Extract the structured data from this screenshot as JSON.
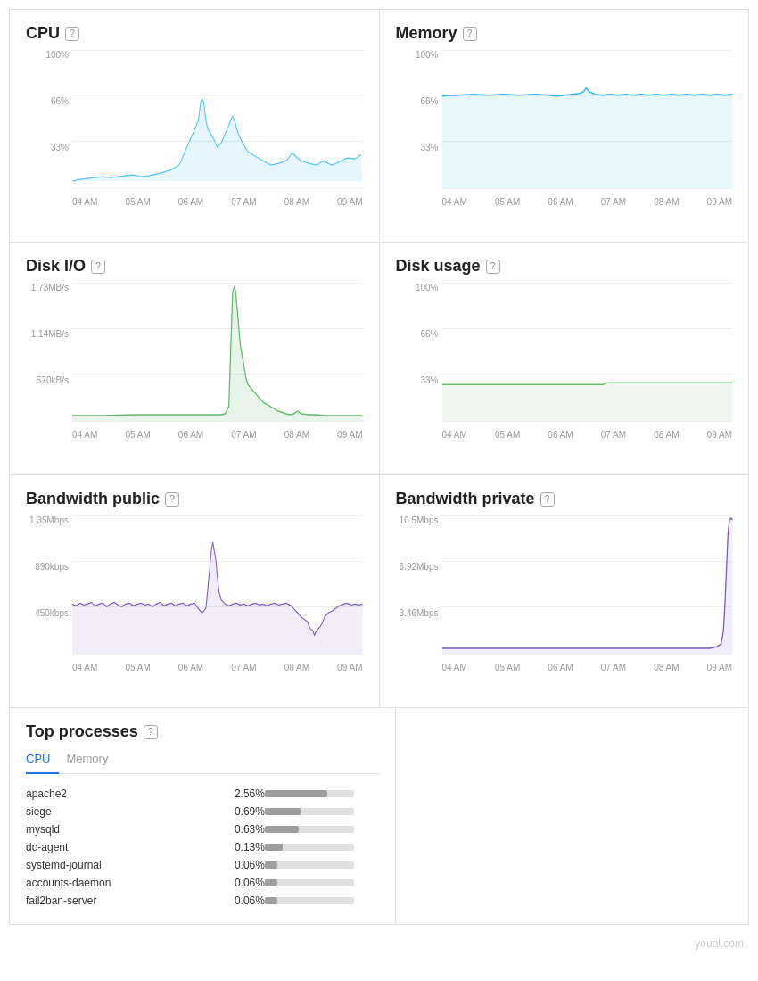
{
  "panels": {
    "cpu": {
      "title": "CPU",
      "y_labels": [
        "100%",
        "66%",
        "33%",
        ""
      ],
      "x_labels": [
        "04 AM",
        "05 AM",
        "06 AM",
        "07 AM",
        "08 AM",
        "09 AM"
      ],
      "color": "#4fc3f7"
    },
    "memory": {
      "title": "Memory",
      "y_labels": [
        "100%",
        "66%",
        "33%",
        ""
      ],
      "x_labels": [
        "04 AM",
        "05 AM",
        "06 AM",
        "07 AM",
        "08 AM",
        "09 AM"
      ],
      "color": "#29b6f6"
    },
    "disk_io": {
      "title": "Disk I/O",
      "y_labels": [
        "1.73MB/s",
        "1.14MB/s",
        "570kB/s",
        ""
      ],
      "x_labels": [
        "04 AM",
        "05 AM",
        "06 AM",
        "07 AM",
        "08 AM",
        "09 AM"
      ],
      "color": "#66bb6a"
    },
    "disk_usage": {
      "title": "Disk usage",
      "y_labels": [
        "100%",
        "66%",
        "33%",
        ""
      ],
      "x_labels": [
        "04 AM",
        "05 AM",
        "06 AM",
        "07 AM",
        "08 AM",
        "09 AM"
      ],
      "color": "#66bb6a"
    },
    "bandwidth_public": {
      "title": "Bandwidth public",
      "y_labels": [
        "1.35Mbps",
        "890kbps",
        "450kbps",
        ""
      ],
      "x_labels": [
        "04 AM",
        "05 AM",
        "06 AM",
        "07 AM",
        "08 AM",
        "09 AM"
      ],
      "color": "#7e57c2"
    },
    "bandwidth_private": {
      "title": "Bandwidth private",
      "y_labels": [
        "10.5Mbps",
        "6.92Mbps",
        "3.46Mbps",
        ""
      ],
      "x_labels": [
        "04 AM",
        "05 AM",
        "06 AM",
        "07 AM",
        "08 AM",
        "09 AM"
      ],
      "color": "#7e57c2"
    }
  },
  "top_processes": {
    "title": "Top processes",
    "tabs": [
      "CPU",
      "Memory"
    ],
    "active_tab": "CPU",
    "processes": [
      {
        "name": "apache2",
        "pct": "2.56%",
        "bar": 70
      },
      {
        "name": "siege",
        "pct": "0.69%",
        "bar": 40
      },
      {
        "name": "mysqld",
        "pct": "0.63%",
        "bar": 38
      },
      {
        "name": "do-agent",
        "pct": "0.13%",
        "bar": 20
      },
      {
        "name": "systemd-journal",
        "pct": "0.06%",
        "bar": 14
      },
      {
        "name": "accounts-daemon",
        "pct": "0.06%",
        "bar": 14
      },
      {
        "name": "fail2ban-server",
        "pct": "0.06%",
        "bar": 14
      }
    ]
  },
  "watermark": "youal.com"
}
